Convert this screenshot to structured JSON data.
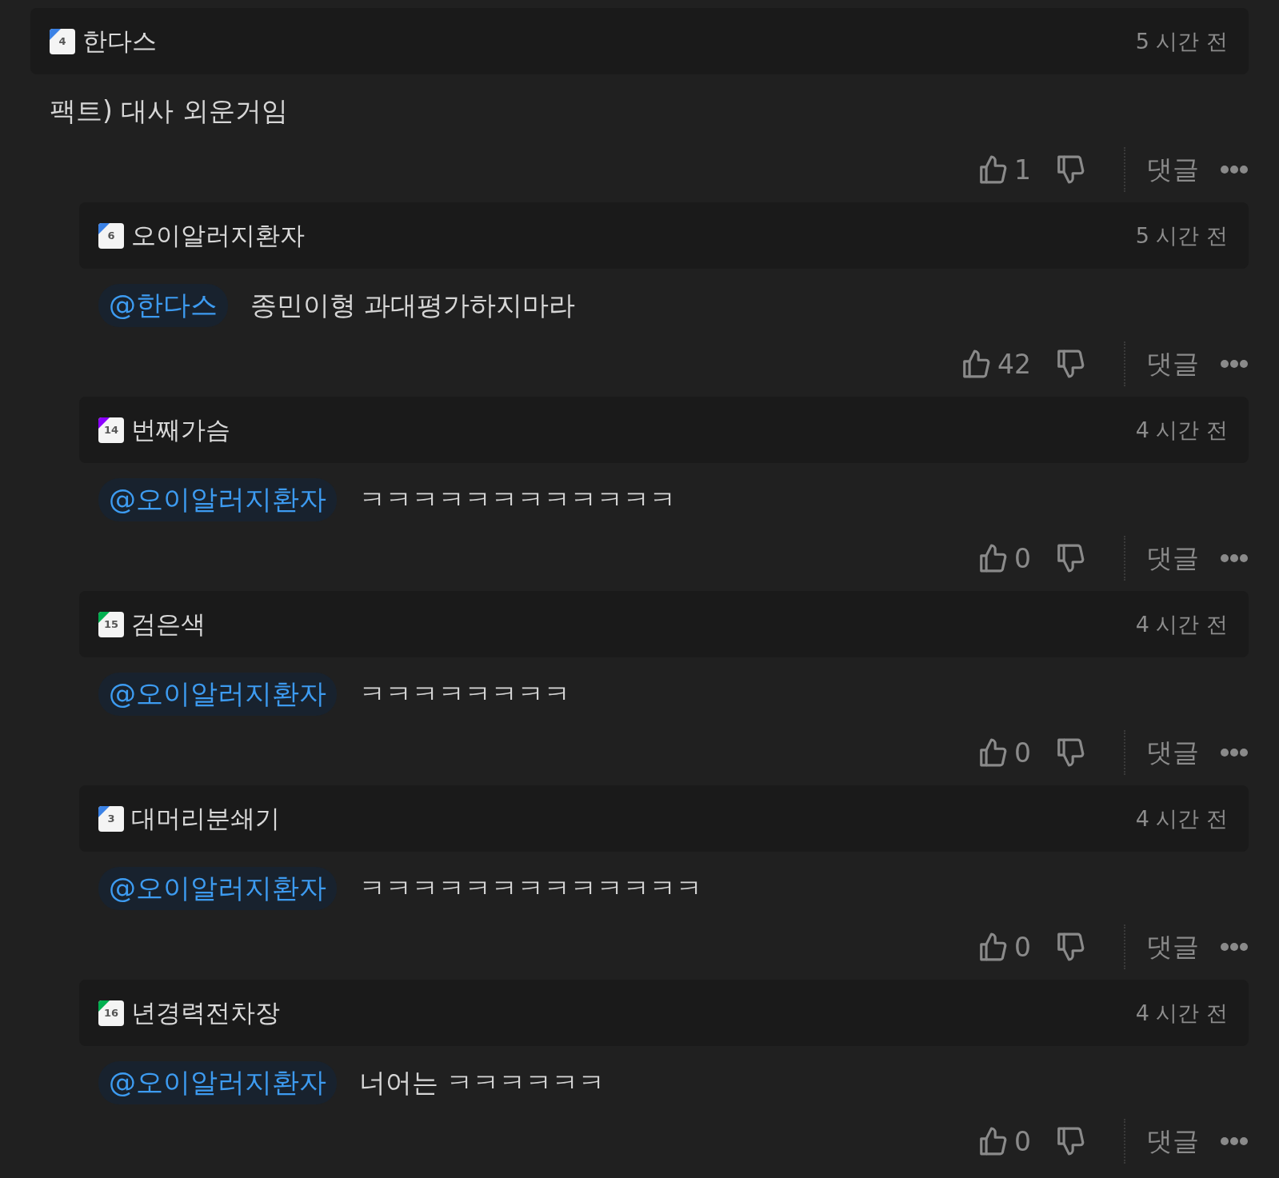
{
  "comments": [
    {
      "level": "4",
      "color": "#3b82e6",
      "author": "한다스",
      "time": "5 시간 전",
      "text": "팩트) 대사 외운거임",
      "likes": "1",
      "reply_label": "댓글",
      "children": [
        {
          "level": "6",
          "color": "#3b82e6",
          "author": "오이알러지환자",
          "time": "5 시간 전",
          "mention": "@한다스",
          "text": "종민이형 과대평가하지마라",
          "likes": "42",
          "reply_label": "댓글"
        },
        {
          "level": "14",
          "color": "#8b00ff",
          "author": "번째가슴",
          "time": "4 시간 전",
          "mention": "@오이알러지환자",
          "text": "ㅋㅋㅋㅋㅋㅋㅋㅋㅋㅋㅋㅋ",
          "likes": "0",
          "reply_label": "댓글"
        },
        {
          "level": "15",
          "color": "#00b050",
          "author": "검은색",
          "time": "4 시간 전",
          "mention": "@오이알러지환자",
          "text": "ㅋㅋㅋㅋㅋㅋㅋㅋ",
          "likes": "0",
          "reply_label": "댓글"
        },
        {
          "level": "3",
          "color": "#3b82e6",
          "author": "대머리분쇄기",
          "time": "4 시간 전",
          "mention": "@오이알러지환자",
          "text": "ㅋㅋㅋㅋㅋㅋㅋㅋㅋㅋㅋㅋㅋ",
          "likes": "0",
          "reply_label": "댓글"
        },
        {
          "level": "16",
          "color": "#00b050",
          "author": "년경력전차장",
          "time": "4 시간 전",
          "mention": "@오이알러지환자",
          "text": "너어는 ㅋㅋㅋㅋㅋㅋ",
          "likes": "0",
          "reply_label": "댓글"
        }
      ]
    }
  ]
}
